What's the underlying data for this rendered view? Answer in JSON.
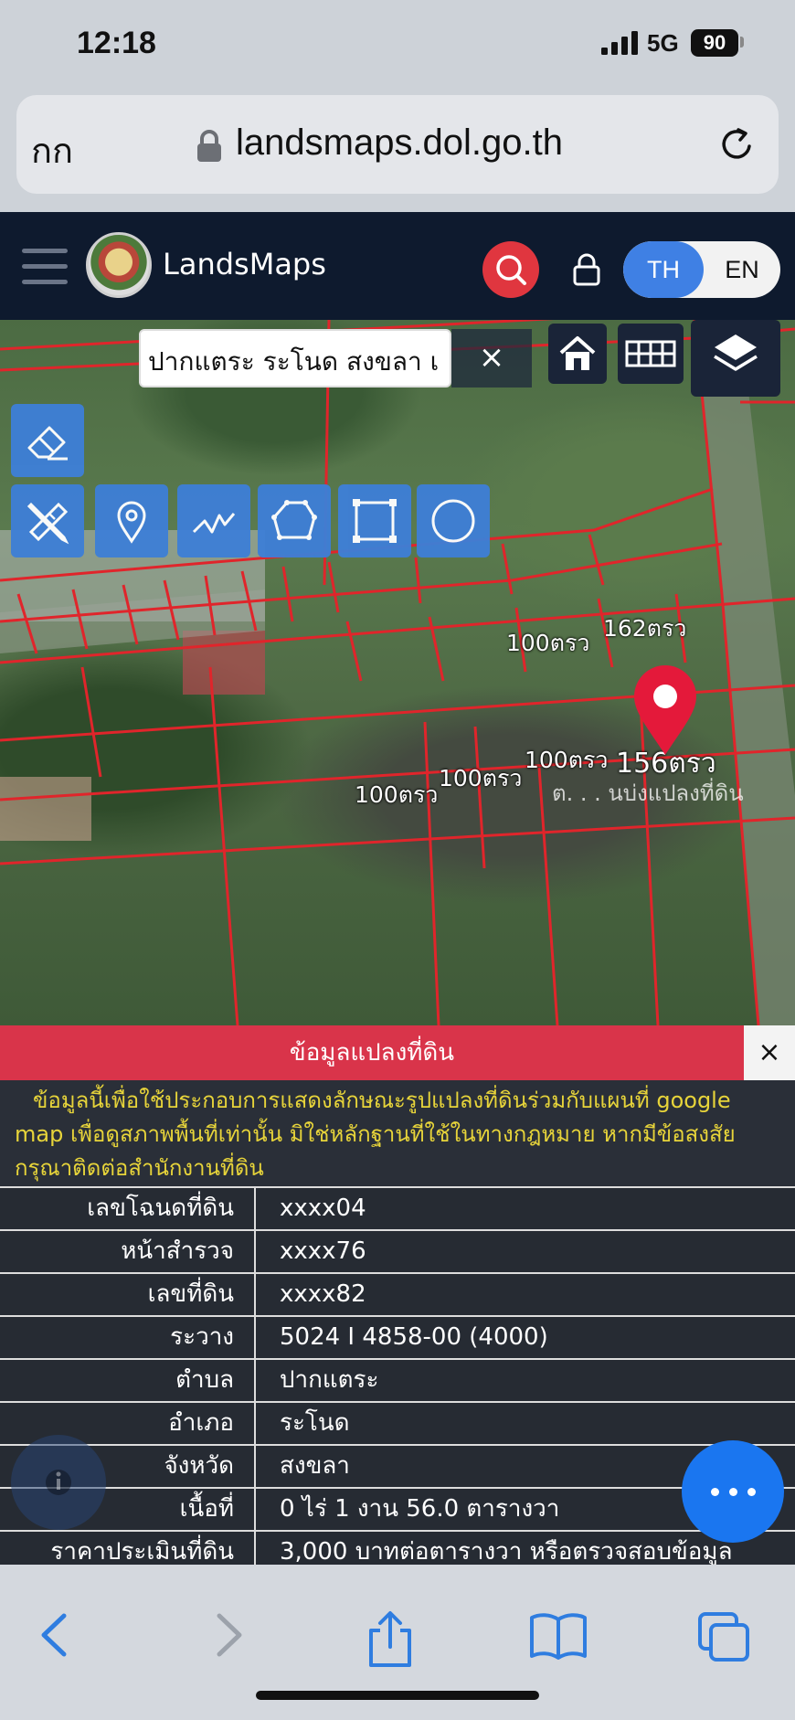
{
  "status_bar": {
    "time": "12:18",
    "network": "5G",
    "battery": "90"
  },
  "browser": {
    "text_size_label": "กก",
    "url": "landsmaps.dol.go.th"
  },
  "app": {
    "brand": "LandsMaps",
    "lang_th": "TH",
    "lang_en": "EN"
  },
  "map": {
    "search_value": "ปากแตระ ระโนด สงขลา เ",
    "clear_label": "×",
    "plot_labels": [
      "100ตรว",
      "162ตรว",
      "100ตรว",
      "100ตรว",
      "100ตรว",
      "156ตรว"
    ],
    "ghost_label": "ต. . . นบ่งแปลงที่ดิน",
    "tools": [
      "eraser-icon",
      "ruler-pencil-icon",
      "pin-icon",
      "polyline-icon",
      "polygon-icon",
      "rectangle-icon",
      "circle-icon"
    ]
  },
  "panel": {
    "title": "ข้อมูลแปลงที่ดิน",
    "close_label": "×",
    "disclaimer": "ข้อมูลนี้เพื่อใช้ประกอบการแสดงลักษณะรูปแปลงที่ดินร่วมกับแผนที่ google map เพื่อดูสภาพพื้นที่เท่านั้น มิใช่หลักฐานที่ใช้ในทางกฎหมาย หากมีข้อสงสัย กรุณาติดต่อสำนักงานที่ดิน",
    "rows": [
      {
        "key": "เลขโฉนดที่ดิน",
        "value": "xxxx04"
      },
      {
        "key": "หน้าสำรวจ",
        "value": "xxxx76"
      },
      {
        "key": "เลขที่ดิน",
        "value": "xxxx82"
      },
      {
        "key": "ระวาง",
        "value": "5024 I 4858-00 (4000)"
      },
      {
        "key": "ตำบล",
        "value": "ปากแตระ"
      },
      {
        "key": "อำเภอ",
        "value": "ระโนด"
      },
      {
        "key": "จังหวัด",
        "value": "สงขลา"
      },
      {
        "key": "เนื้อที่",
        "value": "0 ไร่ 1 งาน 56.0 ตารางวา"
      },
      {
        "key": "ราคาประเมินที่ดิน",
        "value": "3,000 บาทต่อตารางวา หรือตรวจสอบข้อมูล"
      }
    ]
  },
  "colors": {
    "accent_blue": "#3e7fd6",
    "header_bg": "#0e1a2e",
    "panel_red": "#d9344a",
    "disclaimer_yellow": "#e7d43a",
    "fab_blue": "#1a76f0"
  }
}
